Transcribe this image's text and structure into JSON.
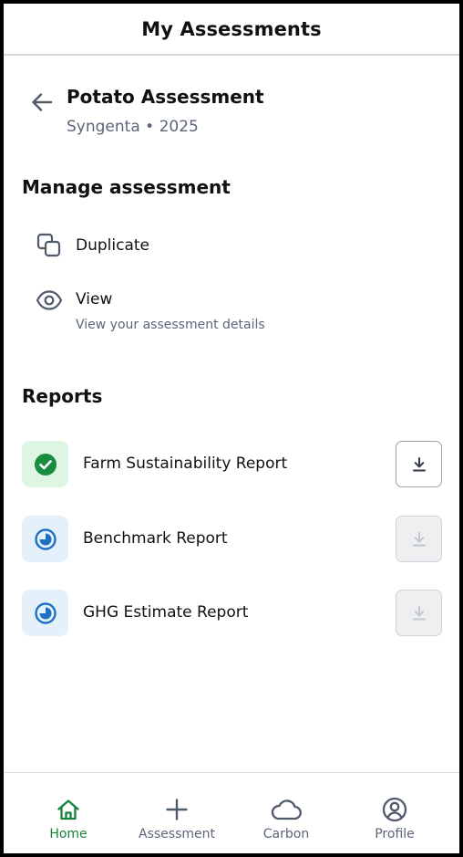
{
  "header": {
    "title": "My Assessments"
  },
  "assessment": {
    "title": "Potato Assessment",
    "subtitle": "Syngenta • 2025"
  },
  "manage": {
    "title": "Manage assessment",
    "duplicate": {
      "label": "Duplicate",
      "icon": "copy-icon"
    },
    "view": {
      "label": "View",
      "description": "View your assessment details",
      "icon": "eye-icon"
    }
  },
  "reports": {
    "title": "Reports",
    "items": [
      {
        "label": "Farm Sustainability Report",
        "status": "complete",
        "status_icon": "check-circle-icon",
        "download_enabled": true
      },
      {
        "label": "Benchmark Report",
        "status": "in-progress",
        "status_icon": "progress-circle-icon",
        "download_enabled": false
      },
      {
        "label": "GHG Estimate Report",
        "status": "in-progress",
        "status_icon": "progress-circle-icon",
        "download_enabled": false
      }
    ]
  },
  "nav": {
    "items": [
      {
        "label": "Home",
        "icon": "home-icon",
        "active": true
      },
      {
        "label": "Assessment",
        "icon": "plus-icon",
        "active": false
      },
      {
        "label": "Carbon",
        "icon": "cloud-icon",
        "active": false
      },
      {
        "label": "Profile",
        "icon": "profile-icon",
        "active": false
      }
    ]
  },
  "colors": {
    "accent_green": "#15833c",
    "complete_bg": "#dff5e3",
    "progress_blue": "#1f6fc5",
    "progress_bg": "#e4f1fb",
    "muted_text": "#5b6678"
  }
}
